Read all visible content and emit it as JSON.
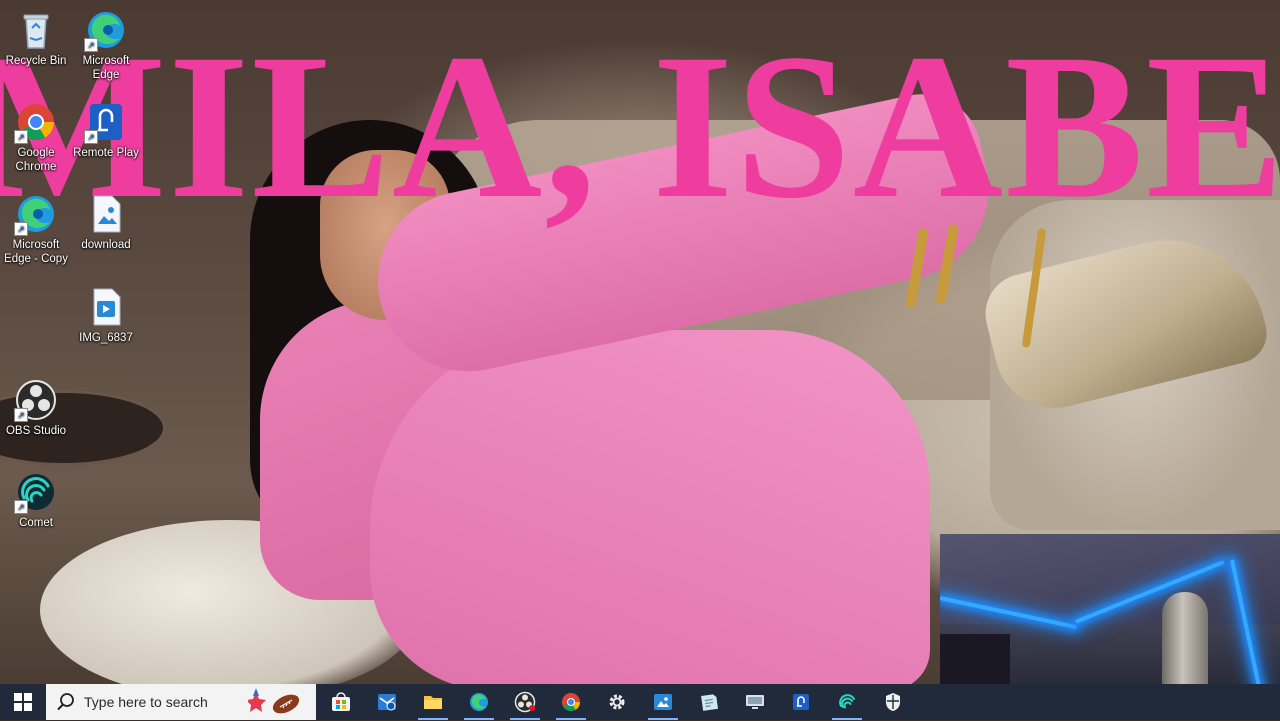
{
  "desktop": {
    "title_text": "MILA, ISABEL",
    "icons": [
      {
        "name": "recycle-bin",
        "label": "Recycle Bin"
      },
      {
        "name": "microsoft-edge",
        "label": "Microsoft Edge"
      },
      {
        "name": "google-chrome",
        "label": "Google Chrome"
      },
      {
        "name": "remote-play",
        "label": "Remote Play"
      },
      {
        "name": "microsoft-edge-copy",
        "label": "Microsoft Edge - Copy"
      },
      {
        "name": "download",
        "label": "download"
      },
      {
        "name": "img-6837",
        "label": "IMG_6837"
      },
      {
        "name": "obs-studio",
        "label": "OBS Studio"
      },
      {
        "name": "comet",
        "label": "Comet"
      }
    ]
  },
  "taskbar": {
    "search_placeholder": "Type here to search",
    "apps": [
      {
        "name": "store",
        "icon": "store-icon"
      },
      {
        "name": "outlook",
        "icon": "mail-icon"
      },
      {
        "name": "file-explorer",
        "icon": "folder-icon"
      },
      {
        "name": "edge",
        "icon": "edge-icon"
      },
      {
        "name": "obs",
        "icon": "obs-icon"
      },
      {
        "name": "chrome",
        "icon": "chrome-icon"
      },
      {
        "name": "settings",
        "icon": "gear-icon"
      },
      {
        "name": "photos",
        "icon": "image-icon"
      },
      {
        "name": "notes",
        "icon": "note-icon"
      },
      {
        "name": "remote-desktop",
        "icon": "monitor-icon"
      },
      {
        "name": "remote-play",
        "icon": "remote-play-icon"
      },
      {
        "name": "comet",
        "icon": "comet-icon"
      },
      {
        "name": "security",
        "icon": "shield-icon"
      }
    ]
  },
  "colors": {
    "title_pink": "#ee3c9f",
    "taskbar_bg": "#202a3a",
    "accent": "#7fb5ff"
  }
}
